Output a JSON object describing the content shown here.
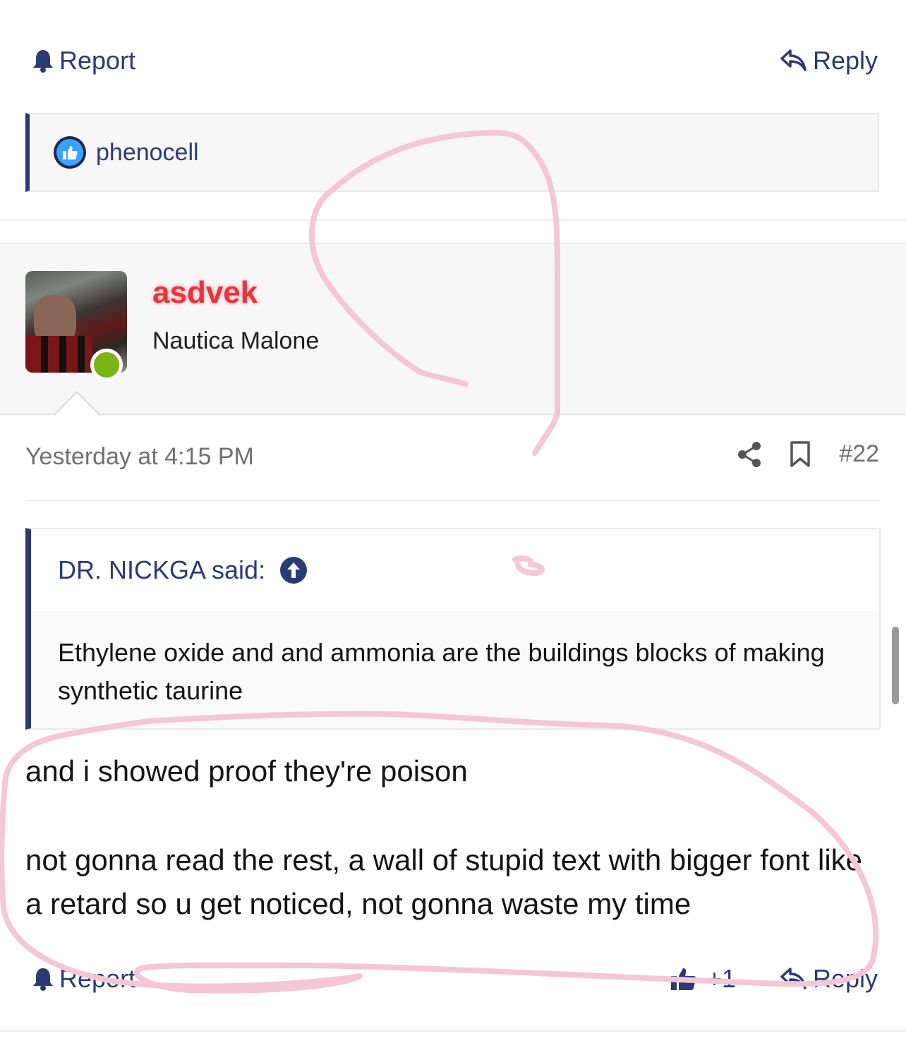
{
  "top_actions": {
    "report_label": "Report",
    "reply_label": "Reply"
  },
  "reactions": {
    "icon": "like-icon",
    "users": "phenocell"
  },
  "post": {
    "author": {
      "username": "asdvek",
      "title": "Nautica Malone",
      "online": true
    },
    "timestamp": "Yesterday at 4:15 PM",
    "post_number": "#22",
    "quote": {
      "author": "DR. NICKGA said:",
      "text": "Ethylene oxide and and ammonia are the buildings blocks of making synthetic taurine"
    },
    "body": [
      "and i showed proof they're poison",
      "not gonna read the rest, a wall of stupid text with bigger font like a retard so u get noticed, not gonna waste my time"
    ],
    "actions": {
      "report_label": "Report",
      "like_count": "+1",
      "reply_label": "Reply"
    }
  },
  "colors": {
    "link": "#2b3a73",
    "username": "#e8343e",
    "online": "#7ab413",
    "annotation": "#f4c6d6"
  }
}
